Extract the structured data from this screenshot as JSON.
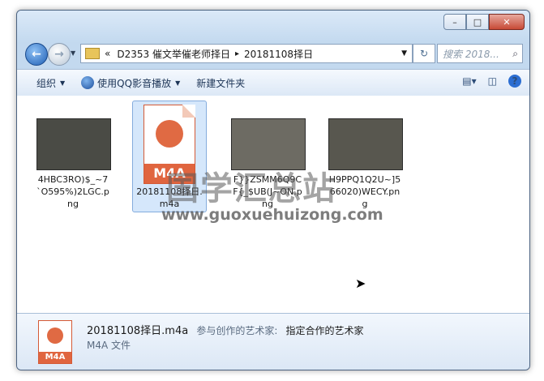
{
  "window": {
    "controls": [
      "–",
      "□",
      "✕"
    ]
  },
  "nav": {
    "back_label": "←",
    "forward_label": "→",
    "address_chevron": "«",
    "address_parts": [
      "D2353 催文举催老师择日",
      "20181108择日"
    ],
    "address_separator": "▸",
    "search_placeholder": "搜索 2018...",
    "refresh_label": "↻"
  },
  "toolbar": {
    "organize_label": "组织",
    "play_label": "使用QQ影音播放",
    "new_folder_label": "新建文件夹"
  },
  "files": [
    {
      "name": "4HBC3RO)$_~7`O595%)2LGC.png",
      "type": "png"
    },
    {
      "name": "20181108择日.m4a",
      "type": "m4a",
      "icon_text": "M4A"
    },
    {
      "name": "F}}ZSMM6Q9CF{_$UB(J~ON.png",
      "type": "png"
    },
    {
      "name": "H9PPQ1Q2U~]566020)WECY.png",
      "type": "png"
    }
  ],
  "watermark": {
    "text": "国学汇总站",
    "url": "www.guoxuehuizong.com"
  },
  "details": {
    "filename": "20181108择日.m4a",
    "artist_label": "参与创作的艺术家:",
    "artist_value": "指定合作的艺术家",
    "filetype": "M4A 文件",
    "icon_text": "M4A"
  },
  "colors": {
    "accent": "#1f5fb5",
    "selection": "#d5e7fb",
    "m4a_orange": "#e0653f"
  }
}
